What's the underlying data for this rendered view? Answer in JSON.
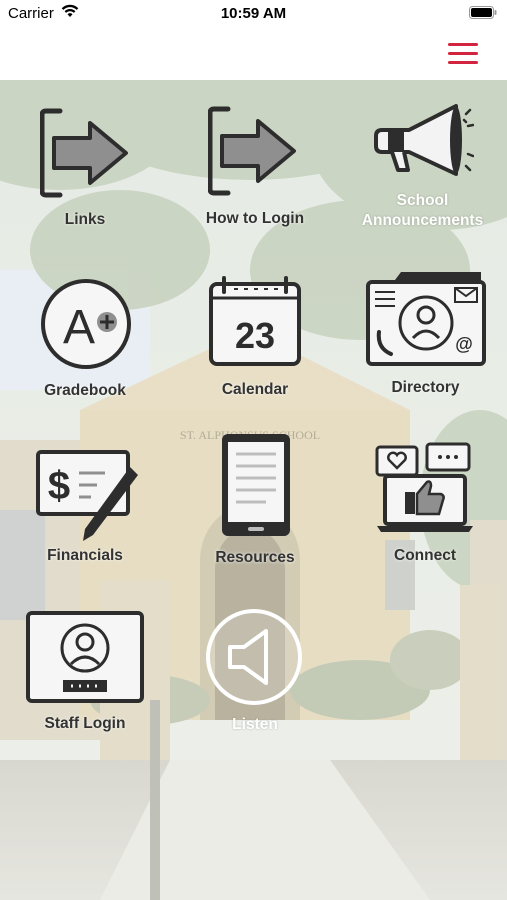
{
  "status_bar": {
    "carrier": "Carrier",
    "time": "10:59 AM"
  },
  "nav": {
    "menu_icon": "hamburger-menu-icon",
    "accent_color": "#d2243f"
  },
  "background": {
    "sign_text": "ST. ALPHONSUS SCHOOL"
  },
  "tiles": [
    {
      "label": "Links",
      "icon": "arrow-bracket-icon"
    },
    {
      "label": "How to Login",
      "icon": "arrow-bracket-icon"
    },
    {
      "label": "School Announcements",
      "line1": "School",
      "line2": "Announcements",
      "icon": "megaphone-icon"
    },
    {
      "label": "Gradebook",
      "icon": "a-plus-grade-icon"
    },
    {
      "label": "Calendar",
      "icon": "calendar-icon",
      "day": "23"
    },
    {
      "label": "Directory",
      "icon": "contact-card-icon"
    },
    {
      "label": "Financials",
      "icon": "check-signing-icon",
      "symbol": "$"
    },
    {
      "label": "Resources",
      "icon": "tablet-document-icon"
    },
    {
      "label": "Connect",
      "icon": "laptop-social-icon"
    },
    {
      "label": "Staff Login",
      "icon": "user-login-screen-icon"
    },
    {
      "label": "Listen",
      "icon": "speaker-icon"
    }
  ]
}
